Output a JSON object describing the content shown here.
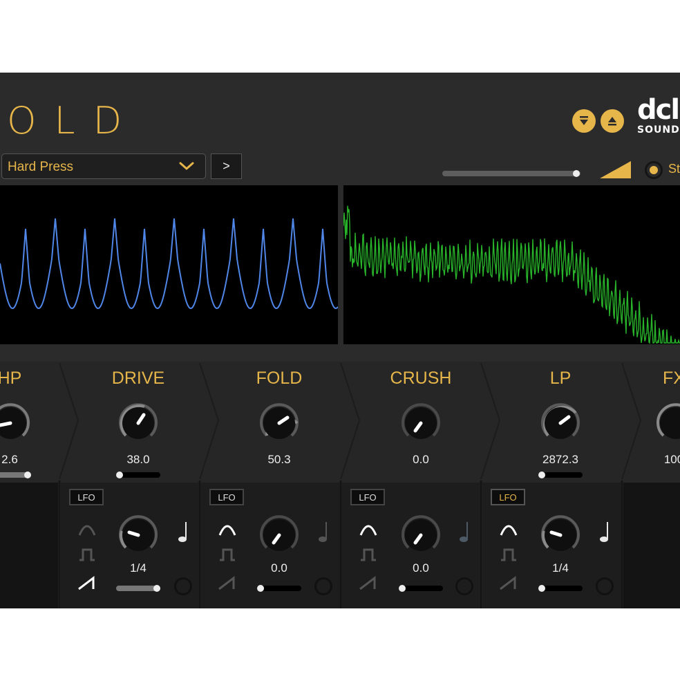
{
  "header": {
    "title": "OLD",
    "preset_name": "Hard Press",
    "next_label": ">",
    "stereo_label": "St",
    "logo_big": "dcl",
    "logo_small": "SOUND",
    "output_level": 0.97
  },
  "colors": {
    "accent": "#e7b64a",
    "panel": "#2b2b2b",
    "wave": "#4f86e8",
    "spectrum": "#28b32a"
  },
  "modules": [
    {
      "name": "HP",
      "value": "2.6"
    },
    {
      "name": "DRIVE",
      "value": "38.0"
    },
    {
      "name": "FOLD",
      "value": "50.3"
    },
    {
      "name": "CRUSH",
      "value": "0.0"
    },
    {
      "name": "LP",
      "value": "2872.3"
    },
    {
      "name": "FX",
      "value": "100"
    }
  ],
  "lfos": [
    {
      "label": "LFO",
      "value": "1/4",
      "active": false
    },
    {
      "label": "LFO",
      "value": "0.0",
      "active": false
    },
    {
      "label": "LFO",
      "value": "0.0",
      "active": false
    },
    {
      "label": "LFO",
      "value": "1/4",
      "active": true
    }
  ],
  "icons": [
    "arrow-down-icon",
    "eject-icon",
    "chevron-down-icon",
    "volume-ramp-icon",
    "triangle-wave-icon",
    "square-wave-icon",
    "saw-wave-icon",
    "note-icon"
  ]
}
